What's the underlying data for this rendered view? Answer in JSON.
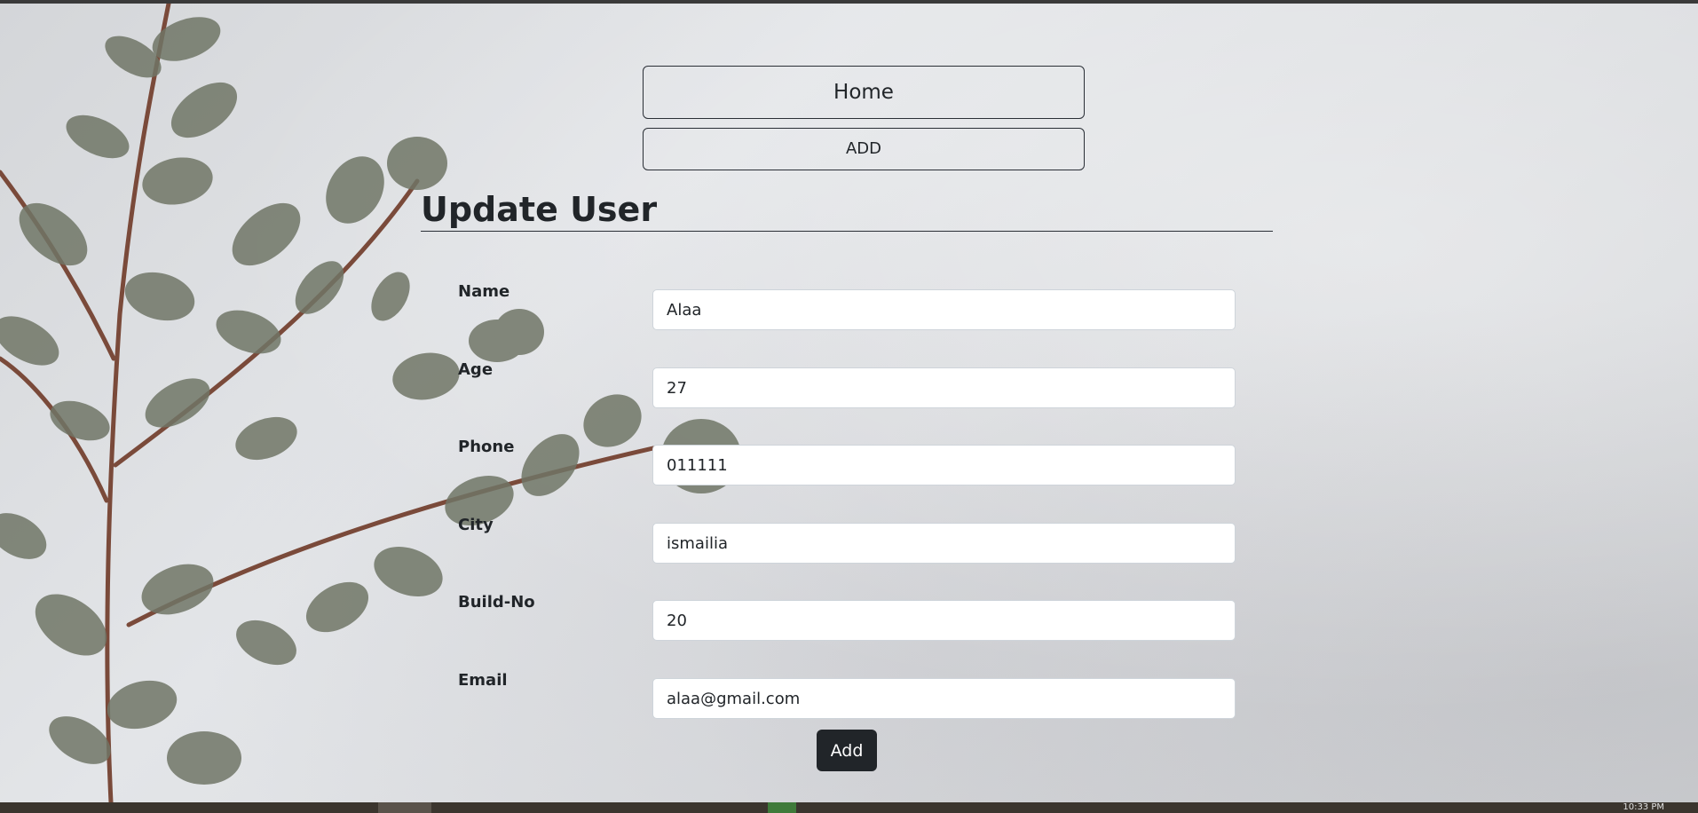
{
  "nav": {
    "home_label": "Home",
    "add_label": "ADD"
  },
  "form": {
    "title": "Update User",
    "fields": [
      {
        "label": "Name",
        "value": "Alaa"
      },
      {
        "label": "Age",
        "value": "27"
      },
      {
        "label": "Phone",
        "value": "011111"
      },
      {
        "label": "City",
        "value": "ismailia"
      },
      {
        "label": "Build-No",
        "value": "20"
      },
      {
        "label": "Email",
        "value": "alaa@gmail.com"
      }
    ],
    "submit_label": "Add"
  },
  "taskbar": {
    "clock": "10:33 PM"
  },
  "colors": {
    "primary_dark": "#212529",
    "input_border": "#ced4da"
  }
}
